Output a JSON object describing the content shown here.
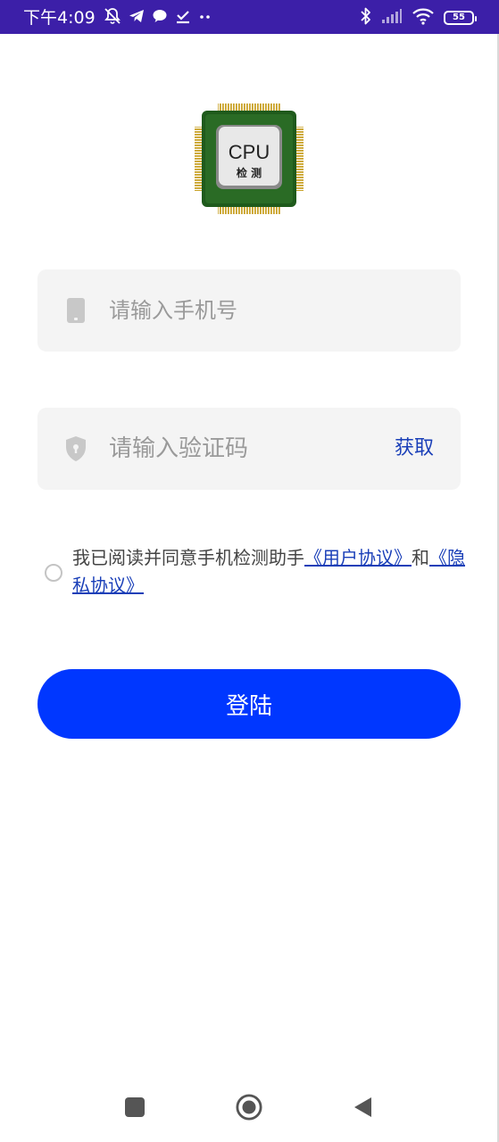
{
  "status_bar": {
    "time": "下午4:09",
    "battery": "55",
    "colors": {
      "background": "#3c1fa8"
    }
  },
  "login": {
    "phone_placeholder": "请输入手机号",
    "phone_icon": "phone-icon",
    "code_placeholder": "请输入验证码",
    "code_icon": "shield-icon",
    "get_code_label": "获取",
    "agreement_text": "我已阅读并同意手机检测助手",
    "user_agreement_link": "《用户协议》",
    "and_text": "和",
    "privacy_link": "《隐私协议》",
    "agreed": false,
    "login_button": "登陆"
  },
  "logo": {
    "title": "CPU",
    "subtitle": "检 测"
  },
  "colors": {
    "accent": "#0037ff",
    "link": "#1a3fb8",
    "field_background": "#f4f4f4"
  },
  "nav": {
    "recent_icon": "square-recent-apps-icon",
    "home_icon": "circle-home-icon",
    "back_icon": "triangle-back-icon"
  }
}
